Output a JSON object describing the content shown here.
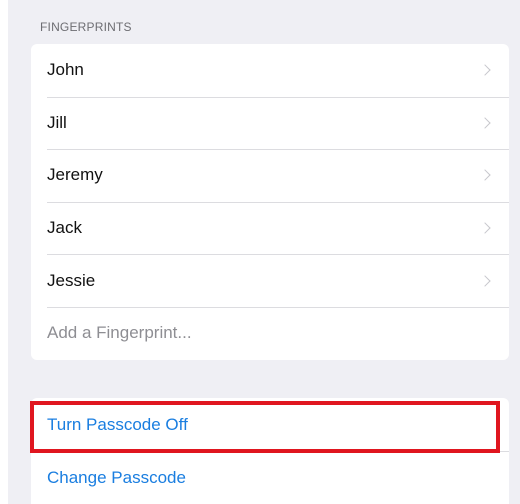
{
  "fingerprints_section": {
    "header": "FINGERPRINTS",
    "items": [
      {
        "label": "John"
      },
      {
        "label": "Jill"
      },
      {
        "label": "Jeremy"
      },
      {
        "label": "Jack"
      },
      {
        "label": "Jessie"
      }
    ],
    "add_label": "Add a Fingerprint..."
  },
  "passcode_section": {
    "turn_off_label": "Turn Passcode Off",
    "change_label": "Change Passcode"
  },
  "colors": {
    "background": "#efeff4",
    "link": "#1a7ee0",
    "highlight": "#e0161f",
    "separator": "#dcdce0"
  },
  "icons": {
    "row_disclosure": "chevron-right-icon"
  }
}
